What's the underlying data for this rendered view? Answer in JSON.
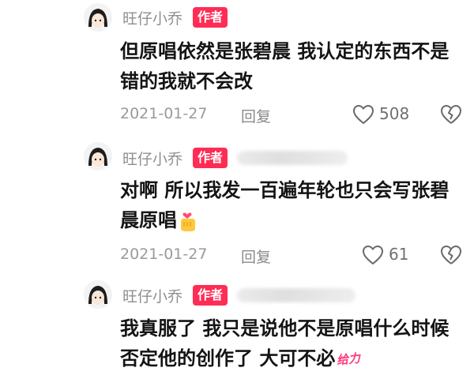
{
  "comments": [
    {
      "username": "旺仔小乔",
      "badge": "作者",
      "text": "但原唱依然是张碧晨 我认定的东西不是错的我就不会改",
      "date": "2021-01-27",
      "reply_label": "回复",
      "like_count": "508"
    },
    {
      "username": "旺仔小乔",
      "badge": "作者",
      "text": "对啊 所以我发一百遍年轮也只会写张碧晨原唱",
      "date": "2021-01-27",
      "reply_label": "回复",
      "like_count": "61"
    },
    {
      "username": "旺仔小乔",
      "badge": "作者",
      "text": "我真服了 我只是说他不是原唱什么时候否定他的创作了 大可不必",
      "sticker_text": "给力"
    }
  ],
  "icons": {
    "like": "heart-outline-icon",
    "dislike": "broken-heart-icon",
    "emoji": "fist-heart-emoji-icon"
  },
  "colors": {
    "badge": "#ff2c55",
    "meta": "#9a9a9a"
  }
}
